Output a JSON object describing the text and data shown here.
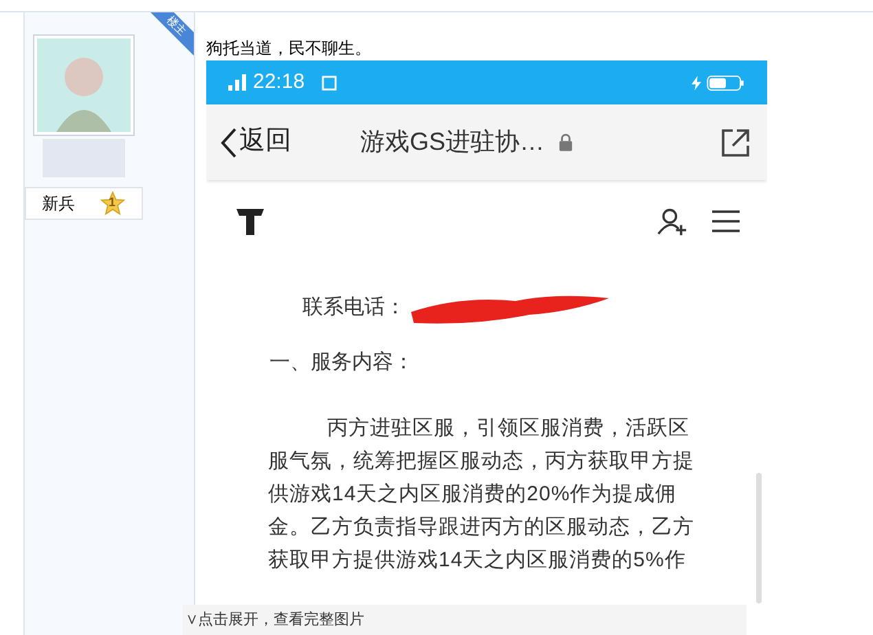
{
  "author": {
    "badge": "楼主",
    "rank": "新兵",
    "rank_level": "1"
  },
  "post": {
    "text": "狗托当道，民不聊生。",
    "screenshot": {
      "status_bar": {
        "time": "22:18"
      },
      "nav": {
        "back": "返回",
        "title": "游戏GS进驻协…"
      },
      "contact_label": "联系电话：",
      "section_heading": "一、服务内容：",
      "paragraph_lines": [
        "丙方进驻区服，引领区服消费，活跃区",
        "服气氛，统筹把握区服动态，丙方获取甲方提",
        "供游戏14天之内区服消费的20%作为提成佣",
        "金。乙方负责指导跟进丙方的区服动态，乙方",
        "获取甲方提供游戏14天之内区服消费的5%作"
      ]
    },
    "expand": "∨点击展开，查看完整图片"
  }
}
